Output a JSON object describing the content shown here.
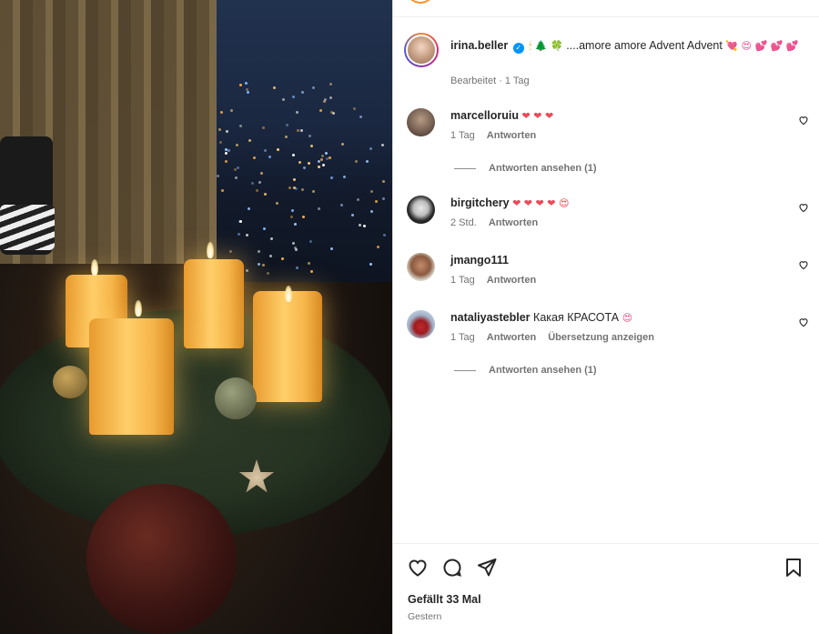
{
  "post": {
    "image_alt": "",
    "author": "irina.beller",
    "caption_emojis_before": "🕯 🌲 🍀",
    "caption_text": "....amore amore Advent Advent",
    "caption_emojis_after": "💘 😍 💕 💕",
    "caption_emoji_wrap": "💕",
    "caption_meta": "Bearbeitet · 1 Tag"
  },
  "comments": [
    {
      "user": "marcelloruiu",
      "text": "",
      "emojis": "❤ ❤ ❤",
      "time": "1 Tag",
      "reply_label": "Antworten",
      "translate_label": "",
      "view_replies": "Antworten ansehen (1)"
    },
    {
      "user": "birgitchery",
      "text": "",
      "emojis": "❤ ❤ ❤ ❤ 😍",
      "time": "2 Std.",
      "reply_label": "Antworten",
      "translate_label": "",
      "view_replies": ""
    },
    {
      "user": "jmango111",
      "text": "",
      "emojis": "",
      "time": "1 Tag",
      "reply_label": "Antworten",
      "translate_label": "",
      "view_replies": ""
    },
    {
      "user": "nataliyastebler",
      "text": "Какая КРАСОТА",
      "emojis": "😍",
      "time": "1 Tag",
      "reply_label": "Antworten",
      "translate_label": "Übersetzung anzeigen",
      "view_replies": "Antworten ansehen (1)"
    }
  ],
  "footer": {
    "likes": "Gefällt 33 Mal",
    "date": "Gestern"
  },
  "icons": {
    "like": "heart-icon",
    "comment": "comment-icon",
    "share": "share-icon",
    "save": "bookmark-icon",
    "comment_like": "heart-icon"
  },
  "colors": {
    "verified": "#0095f6",
    "heart_red": "#ed4956",
    "muted_text": "#737373"
  }
}
